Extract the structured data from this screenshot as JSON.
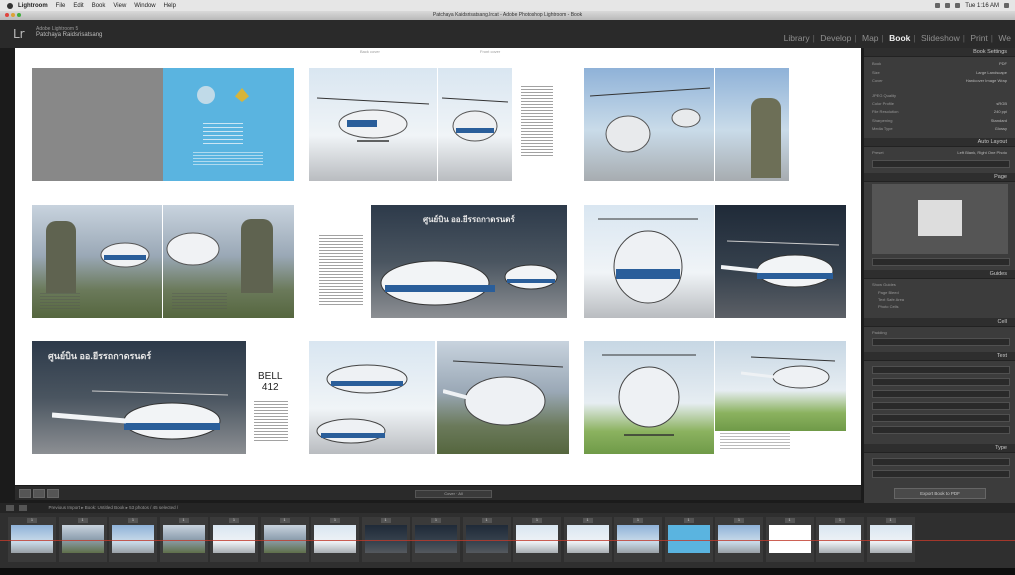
{
  "menubar": {
    "app": "Lightroom",
    "items": [
      "File",
      "Edit",
      "Book",
      "View",
      "Window",
      "Help"
    ],
    "clock": "Tue 1:16 AM"
  },
  "window": {
    "title": "Patchaya Kaidsrisatsang.lrcat - Adobe Photoshop Lightroom - Book"
  },
  "identity": {
    "logo": "Lr",
    "line1": "Adobe Lightroom 5",
    "line2": "Patchaya Raidsrisatsang"
  },
  "modules": {
    "items": [
      "Library",
      "Develop",
      "Map",
      "Book",
      "Slideshow",
      "Print",
      "We"
    ],
    "active": "Book"
  },
  "canvas": {
    "header_left": "Back cover",
    "header_right": "Front cover",
    "bell_title": "BELL",
    "bell_number": "412",
    "hangar_text": "ศูนย์บิน ออ.ยีรรถกาดรนดร์"
  },
  "panels": {
    "book_settings": "Book Settings",
    "auto_layout": "Auto Layout",
    "page": "Page",
    "guides": "Guides",
    "cell": "Cell",
    "text": "Text",
    "type": "Type",
    "export_button": "Export Book to PDF",
    "rows": {
      "book": "Book",
      "book_val": "PDF",
      "size": "Size",
      "size_val": "Large Landscape",
      "cover": "Cover",
      "cover_val": "Hardcover Image Wrap",
      "quality": "JPEG Quality",
      "color_profile": "Color Profile",
      "color_profile_val": "sRGB",
      "resolution": "File Resolution",
      "resolution_val": "240 ppi",
      "sharpening": "Sharpening",
      "sharpening_val": "Standard",
      "media_type": "Media Type",
      "media_type_val": "Glossy",
      "preset": "Preset",
      "preset_val": "Left Blank, Right One Photo",
      "show_guides": "Show Guides",
      "page_bleed": "Page Bleed",
      "text_safe_area": "Text Safe Area",
      "photo_cells": "Photo Cells",
      "padding": "Padding"
    }
  },
  "toolbar": {
    "zoom_label": "Cover · All"
  },
  "filmbar": {
    "path": "Previous Import  ▸  Book: Untitled Book  ▸  53 photos / 45 selected /"
  },
  "filmstrip": {
    "badges": [
      "1",
      "1",
      "1",
      "1",
      "1",
      "1",
      "1",
      "1",
      "1",
      "1",
      "1",
      "1",
      "1",
      "1",
      "1",
      "1",
      "1",
      "1"
    ]
  },
  "colors": {
    "accent_blue": "#5ab4e0",
    "panel_bg": "#3c3c3c",
    "canvas_bg": "#ffffff"
  }
}
